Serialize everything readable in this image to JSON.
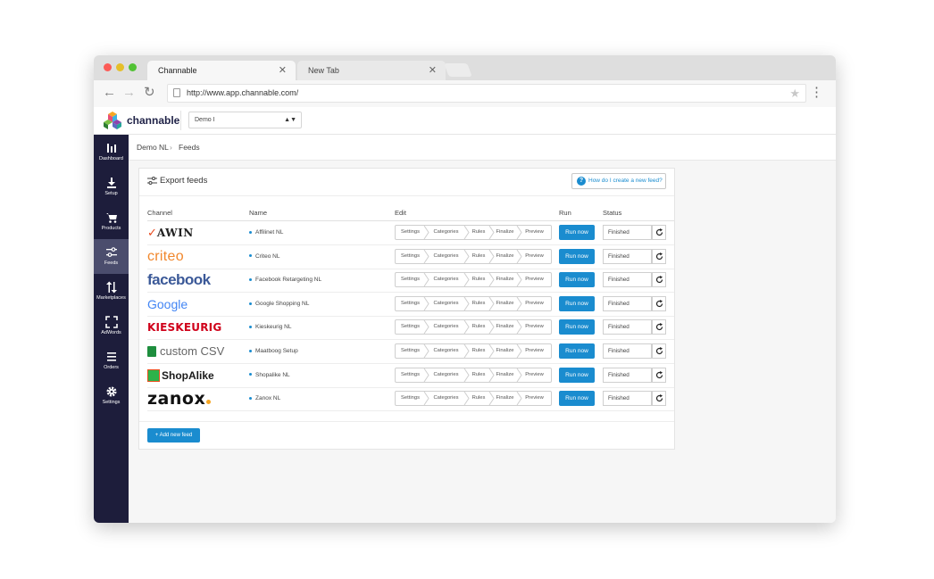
{
  "browser": {
    "tabs": [
      {
        "label": "Channable",
        "close": "✕"
      },
      {
        "label": "New Tab",
        "close": "✕"
      }
    ],
    "url": "http://www.app.channable.com/"
  },
  "app": {
    "brand": "channable",
    "project_select": "Demo I"
  },
  "sidebar": [
    {
      "label": "Dashboard",
      "icon": "bar-chart-icon"
    },
    {
      "label": "Setup",
      "icon": "download-icon"
    },
    {
      "label": "Products",
      "icon": "cart-icon"
    },
    {
      "label": "Feeds",
      "icon": "sliders-icon"
    },
    {
      "label": "Marketplaces",
      "icon": "arrows-updown-icon"
    },
    {
      "label": "AdWords",
      "icon": "expand-icon"
    },
    {
      "label": "Orders",
      "icon": "list-icon"
    },
    {
      "label": "Settings",
      "icon": "gear-icon"
    }
  ],
  "breadcrumb": [
    "Demo NL",
    "Feeds"
  ],
  "panel": {
    "title": "Export feeds",
    "help": "How do I create a new feed?",
    "columns": [
      "Channel",
      "Name",
      "Edit",
      "Run",
      "Status"
    ],
    "steps": [
      "Settings",
      "Categories",
      "Rules",
      "Finalize",
      "Preview"
    ],
    "run_label": "Run now",
    "add_label": "Add new feed",
    "rows": [
      {
        "channel": "AWIN",
        "name": "Affilinet NL",
        "status": "Finished"
      },
      {
        "channel": "criteo",
        "name": "Criteo NL",
        "status": "Finished"
      },
      {
        "channel": "facebook",
        "name": "Facebook Retargeting NL",
        "status": "Finished"
      },
      {
        "channel": "Google",
        "name": "Google Shopping NL",
        "status": "Finished"
      },
      {
        "channel": "KIESKEURIG",
        "name": "Kieskeurig NL",
        "status": "Finished"
      },
      {
        "channel": "custom CSV",
        "name": "Maatboog Setup",
        "status": "Finished"
      },
      {
        "channel": "ShopAlike",
        "name": "Shopalike NL",
        "status": "Finished"
      },
      {
        "channel": "zanox",
        "name": "Zanox NL",
        "status": "Finished"
      }
    ]
  },
  "colors": {
    "sidebar": "#1d1d3b",
    "sidebar_active": "#4b4d6d",
    "accent": "#1a8ccf"
  }
}
